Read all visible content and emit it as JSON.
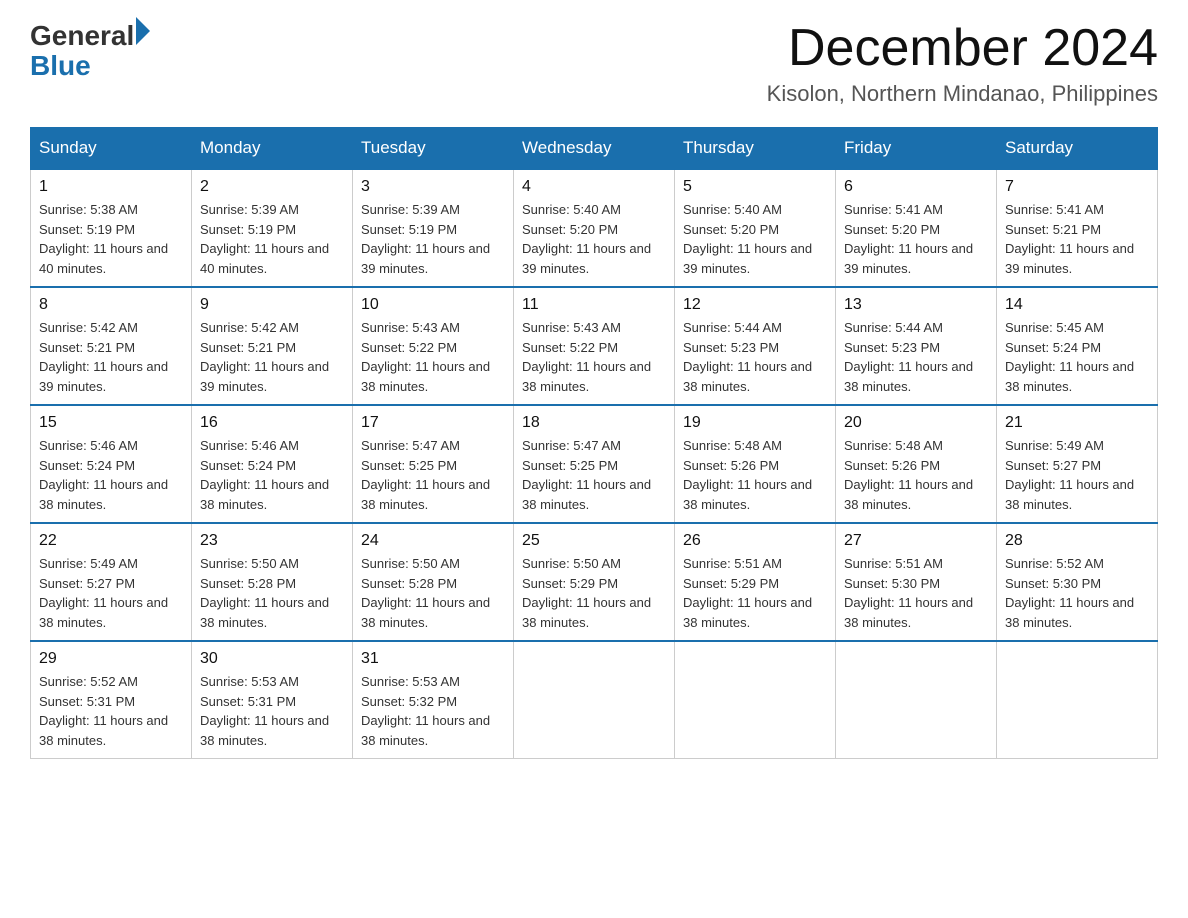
{
  "header": {
    "logo": {
      "general": "General",
      "blue_arrow": "▶",
      "blue": "Blue"
    },
    "title": "December 2024",
    "location": "Kisolon, Northern Mindanao, Philippines"
  },
  "calendar": {
    "days_of_week": [
      "Sunday",
      "Monday",
      "Tuesday",
      "Wednesday",
      "Thursday",
      "Friday",
      "Saturday"
    ],
    "weeks": [
      [
        {
          "day": "1",
          "sunrise": "5:38 AM",
          "sunset": "5:19 PM",
          "daylight": "11 hours and 40 minutes."
        },
        {
          "day": "2",
          "sunrise": "5:39 AM",
          "sunset": "5:19 PM",
          "daylight": "11 hours and 40 minutes."
        },
        {
          "day": "3",
          "sunrise": "5:39 AM",
          "sunset": "5:19 PM",
          "daylight": "11 hours and 39 minutes."
        },
        {
          "day": "4",
          "sunrise": "5:40 AM",
          "sunset": "5:20 PM",
          "daylight": "11 hours and 39 minutes."
        },
        {
          "day": "5",
          "sunrise": "5:40 AM",
          "sunset": "5:20 PM",
          "daylight": "11 hours and 39 minutes."
        },
        {
          "day": "6",
          "sunrise": "5:41 AM",
          "sunset": "5:20 PM",
          "daylight": "11 hours and 39 minutes."
        },
        {
          "day": "7",
          "sunrise": "5:41 AM",
          "sunset": "5:21 PM",
          "daylight": "11 hours and 39 minutes."
        }
      ],
      [
        {
          "day": "8",
          "sunrise": "5:42 AM",
          "sunset": "5:21 PM",
          "daylight": "11 hours and 39 minutes."
        },
        {
          "day": "9",
          "sunrise": "5:42 AM",
          "sunset": "5:21 PM",
          "daylight": "11 hours and 39 minutes."
        },
        {
          "day": "10",
          "sunrise": "5:43 AM",
          "sunset": "5:22 PM",
          "daylight": "11 hours and 38 minutes."
        },
        {
          "day": "11",
          "sunrise": "5:43 AM",
          "sunset": "5:22 PM",
          "daylight": "11 hours and 38 minutes."
        },
        {
          "day": "12",
          "sunrise": "5:44 AM",
          "sunset": "5:23 PM",
          "daylight": "11 hours and 38 minutes."
        },
        {
          "day": "13",
          "sunrise": "5:44 AM",
          "sunset": "5:23 PM",
          "daylight": "11 hours and 38 minutes."
        },
        {
          "day": "14",
          "sunrise": "5:45 AM",
          "sunset": "5:24 PM",
          "daylight": "11 hours and 38 minutes."
        }
      ],
      [
        {
          "day": "15",
          "sunrise": "5:46 AM",
          "sunset": "5:24 PM",
          "daylight": "11 hours and 38 minutes."
        },
        {
          "day": "16",
          "sunrise": "5:46 AM",
          "sunset": "5:24 PM",
          "daylight": "11 hours and 38 minutes."
        },
        {
          "day": "17",
          "sunrise": "5:47 AM",
          "sunset": "5:25 PM",
          "daylight": "11 hours and 38 minutes."
        },
        {
          "day": "18",
          "sunrise": "5:47 AM",
          "sunset": "5:25 PM",
          "daylight": "11 hours and 38 minutes."
        },
        {
          "day": "19",
          "sunrise": "5:48 AM",
          "sunset": "5:26 PM",
          "daylight": "11 hours and 38 minutes."
        },
        {
          "day": "20",
          "sunrise": "5:48 AM",
          "sunset": "5:26 PM",
          "daylight": "11 hours and 38 minutes."
        },
        {
          "day": "21",
          "sunrise": "5:49 AM",
          "sunset": "5:27 PM",
          "daylight": "11 hours and 38 minutes."
        }
      ],
      [
        {
          "day": "22",
          "sunrise": "5:49 AM",
          "sunset": "5:27 PM",
          "daylight": "11 hours and 38 minutes."
        },
        {
          "day": "23",
          "sunrise": "5:50 AM",
          "sunset": "5:28 PM",
          "daylight": "11 hours and 38 minutes."
        },
        {
          "day": "24",
          "sunrise": "5:50 AM",
          "sunset": "5:28 PM",
          "daylight": "11 hours and 38 minutes."
        },
        {
          "day": "25",
          "sunrise": "5:50 AM",
          "sunset": "5:29 PM",
          "daylight": "11 hours and 38 minutes."
        },
        {
          "day": "26",
          "sunrise": "5:51 AM",
          "sunset": "5:29 PM",
          "daylight": "11 hours and 38 minutes."
        },
        {
          "day": "27",
          "sunrise": "5:51 AM",
          "sunset": "5:30 PM",
          "daylight": "11 hours and 38 minutes."
        },
        {
          "day": "28",
          "sunrise": "5:52 AM",
          "sunset": "5:30 PM",
          "daylight": "11 hours and 38 minutes."
        }
      ],
      [
        {
          "day": "29",
          "sunrise": "5:52 AM",
          "sunset": "5:31 PM",
          "daylight": "11 hours and 38 minutes."
        },
        {
          "day": "30",
          "sunrise": "5:53 AM",
          "sunset": "5:31 PM",
          "daylight": "11 hours and 38 minutes."
        },
        {
          "day": "31",
          "sunrise": "5:53 AM",
          "sunset": "5:32 PM",
          "daylight": "11 hours and 38 minutes."
        },
        null,
        null,
        null,
        null
      ]
    ],
    "labels": {
      "sunrise": "Sunrise: ",
      "sunset": "Sunset: ",
      "daylight": "Daylight: "
    }
  }
}
